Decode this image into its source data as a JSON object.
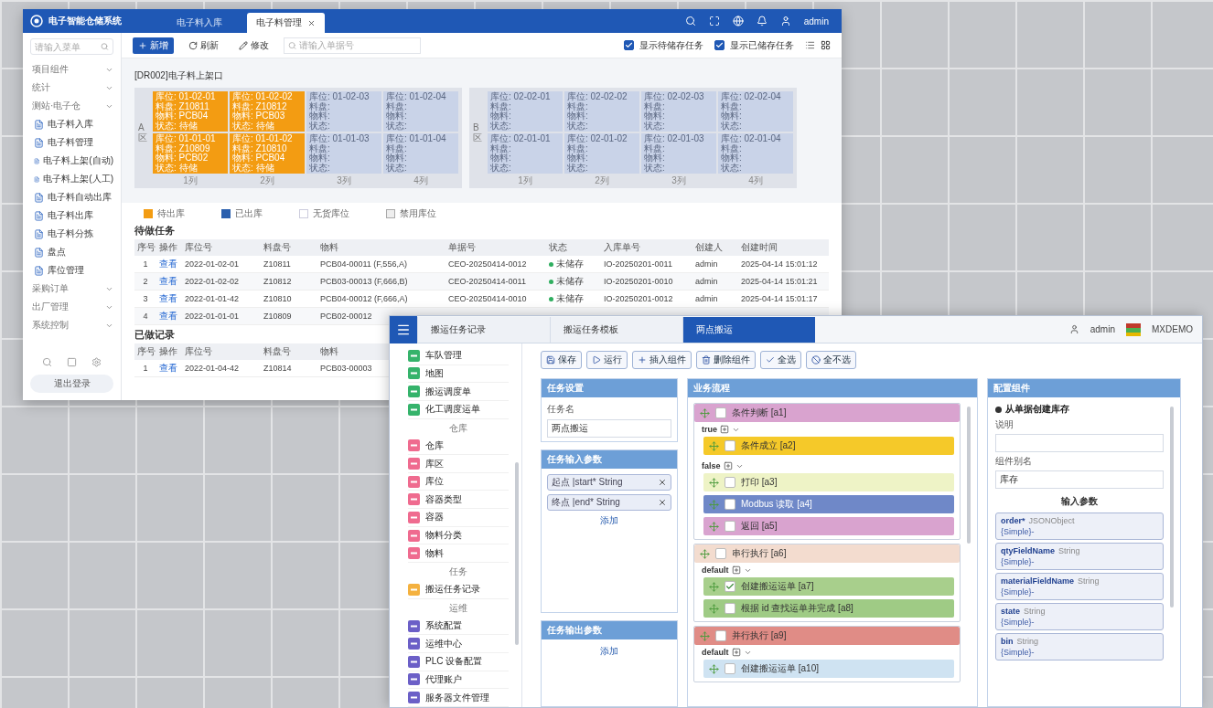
{
  "main_window": {
    "app_title": "电子智能仓储系统",
    "tabs": [
      {
        "label": "电子料入库",
        "selected": false
      },
      {
        "label": "电子料管理",
        "selected": true
      }
    ],
    "user": "admin",
    "sidebar": {
      "search_placeholder": "请输入菜单",
      "items": [
        {
          "kind": "group",
          "label": "项目组件"
        },
        {
          "kind": "group",
          "label": "统计"
        },
        {
          "kind": "group",
          "label": "测站·电子仓"
        },
        {
          "kind": "page",
          "label": "电子料入库"
        },
        {
          "kind": "page",
          "label": "电子料管理"
        },
        {
          "kind": "page",
          "label": "电子料上架(自动)"
        },
        {
          "kind": "page",
          "label": "电子料上架(人工)"
        },
        {
          "kind": "page",
          "label": "电子料自动出库"
        },
        {
          "kind": "page",
          "label": "电子料出库"
        },
        {
          "kind": "page",
          "label": "电子料分拣"
        },
        {
          "kind": "page",
          "label": "盘点"
        },
        {
          "kind": "page",
          "label": "库位管理"
        },
        {
          "kind": "group",
          "label": "采购订单"
        },
        {
          "kind": "group",
          "label": "出厂管理"
        },
        {
          "kind": "group",
          "label": "系统控制"
        }
      ],
      "logout": "退出登录"
    },
    "toolbar": {
      "buttons": [
        {
          "kind": "add",
          "label": "新增"
        },
        {
          "kind": "refresh",
          "label": "刷新"
        },
        {
          "kind": "edit",
          "label": "修改"
        }
      ],
      "search_placeholder": "请输入单据号",
      "filters": [
        {
          "label": "显示待储存任务",
          "checked": true
        },
        {
          "label": "显示已储存任务",
          "checked": true
        }
      ]
    },
    "rack_panel": {
      "title": "[DR002]电子料上架口",
      "racks": [
        {
          "side_label": "A区",
          "column_labels": [
            "1列",
            "2列",
            "3列",
            "4列"
          ],
          "cells": [
            {
              "kind": "occupied",
              "lines": [
                "库位: 01-02-01",
                "料盘: Z10811",
                "物料: PCB04",
                "状态: 待储"
              ]
            },
            {
              "kind": "occupied",
              "lines": [
                "库位: 01-02-02",
                "料盘: Z10812",
                "物料: PCB03",
                "状态: 待储"
              ]
            },
            {
              "kind": "empty",
              "lines": [
                "库位: 01-02-03",
                "料盘:",
                "物料:",
                "状态:"
              ]
            },
            {
              "kind": "empty",
              "lines": [
                "库位: 01-02-04",
                "料盘:",
                "物料:",
                "状态:"
              ]
            },
            {
              "kind": "occupied",
              "lines": [
                "库位: 01-01-01",
                "料盘: Z10809",
                "物料: PCB02",
                "状态: 待储"
              ]
            },
            {
              "kind": "occupied",
              "lines": [
                "库位: 01-01-02",
                "料盘: Z10810",
                "物料: PCB04",
                "状态: 待储"
              ]
            },
            {
              "kind": "empty",
              "lines": [
                "库位: 01-01-03",
                "料盘:",
                "物料:",
                "状态:"
              ]
            },
            {
              "kind": "empty",
              "lines": [
                "库位: 01-01-04",
                "料盘:",
                "物料:",
                "状态:"
              ]
            }
          ]
        },
        {
          "side_label": "B区",
          "column_labels": [
            "1列",
            "2列",
            "3列",
            "4列"
          ],
          "cells": [
            {
              "kind": "empty",
              "lines": [
                "库位: 02-02-01",
                "料盘:",
                "物料:",
                "状态:"
              ]
            },
            {
              "kind": "empty",
              "lines": [
                "库位: 02-02-02",
                "料盘:",
                "物料:",
                "状态:"
              ]
            },
            {
              "kind": "empty",
              "lines": [
                "库位: 02-02-03",
                "料盘:",
                "物料:",
                "状态:"
              ]
            },
            {
              "kind": "empty",
              "lines": [
                "库位: 02-02-04",
                "料盘:",
                "物料:",
                "状态:"
              ]
            },
            {
              "kind": "empty",
              "lines": [
                "库位: 02-01-01",
                "料盘:",
                "物料:",
                "状态:"
              ]
            },
            {
              "kind": "empty",
              "lines": [
                "库位: 02-01-02",
                "料盘:",
                "物料:",
                "状态:"
              ]
            },
            {
              "kind": "empty",
              "lines": [
                "库位: 02-01-03",
                "料盘:",
                "物料:",
                "状态:"
              ]
            },
            {
              "kind": "empty",
              "lines": [
                "库位: 02-01-04",
                "料盘:",
                "物料:",
                "状态:"
              ]
            }
          ]
        }
      ]
    },
    "legend": [
      {
        "kind": "pending",
        "label": "待出库"
      },
      {
        "kind": "done",
        "label": "已出库"
      },
      {
        "kind": "empty",
        "label": "无货库位"
      },
      {
        "kind": "disabled",
        "label": "禁用库位"
      }
    ],
    "pending_tasks": {
      "title": "待做任务",
      "columns": [
        "序号",
        "操作",
        "库位号",
        "料盘号",
        "物料",
        "单据号",
        "状态",
        "入库单号",
        "创建人",
        "创建时间"
      ],
      "rows": [
        {
          "no": "1",
          "action": "查看",
          "bin": "2022-01-02-01",
          "tray": "Z10811",
          "material": "PCB04-00011 (F,556,A)",
          "order": "CEO-20250414-0012",
          "status": "未储存",
          "inbound": "IO-20250201-0011",
          "creator": "admin",
          "created": "2025-04-14 15:01:12"
        },
        {
          "no": "2",
          "action": "查看",
          "bin": "2022-01-02-02",
          "tray": "Z10812",
          "material": "PCB03-00013 (F,666,B)",
          "order": "CEO-20250414-0011",
          "status": "未储存",
          "inbound": "IO-20250201-0010",
          "creator": "admin",
          "created": "2025-04-14 15:01:21"
        },
        {
          "no": "3",
          "action": "查看",
          "bin": "2022-01-01-42",
          "tray": "Z10810",
          "material": "PCB04-00012 (F,666,A)",
          "order": "CEO-20250414-0010",
          "status": "未储存",
          "inbound": "IO-20250201-0012",
          "creator": "admin",
          "created": "2025-04-14 15:01:17"
        },
        {
          "no": "4",
          "action": "查看",
          "bin": "2022-01-01-01",
          "tray": "Z10809",
          "material": "PCB02-00012"
        }
      ]
    },
    "done_records": {
      "title": "已做记录",
      "columns": [
        "序号",
        "操作",
        "库位号",
        "料盘号",
        "物料"
      ],
      "rows": [
        {
          "no": "1",
          "action": "查看",
          "bin": "2022-01-04-42",
          "tray": "Z10814",
          "material": "PCB03-00003"
        }
      ]
    }
  },
  "editor_window": {
    "tabs": [
      {
        "label": "搬运任务记录",
        "selected": false
      },
      {
        "label": "搬运任务模板",
        "selected": false
      },
      {
        "label": "两点搬运",
        "selected": true
      }
    ],
    "user": "admin",
    "brand": "MXDEMO",
    "sidebar": [
      {
        "kind": "item",
        "label": "车队管理",
        "color": "#35b36b"
      },
      {
        "kind": "item",
        "label": "地图",
        "color": "#35b36b"
      },
      {
        "kind": "item",
        "label": "搬运调度单",
        "color": "#35b36b"
      },
      {
        "kind": "item",
        "label": "化工调度运单",
        "color": "#35b36b"
      },
      {
        "kind": "section",
        "label": "仓库"
      },
      {
        "kind": "item",
        "label": "仓库",
        "color": "#ef6b8f"
      },
      {
        "kind": "item",
        "label": "库区",
        "color": "#ef6b8f"
      },
      {
        "kind": "item",
        "label": "库位",
        "color": "#ef6b8f"
      },
      {
        "kind": "item",
        "label": "容器类型",
        "color": "#ef6b8f"
      },
      {
        "kind": "item",
        "label": "容器",
        "color": "#ef6b8f"
      },
      {
        "kind": "item",
        "label": "物料分类",
        "color": "#ef6b8f"
      },
      {
        "kind": "item",
        "label": "物料",
        "color": "#ef6b8f"
      },
      {
        "kind": "section",
        "label": "任务"
      },
      {
        "kind": "item",
        "label": "搬运任务记录",
        "color": "#f4b13f"
      },
      {
        "kind": "section",
        "label": "运维"
      },
      {
        "kind": "item",
        "label": "系统配置",
        "color": "#6b5fc7"
      },
      {
        "kind": "item",
        "label": "运维中心",
        "color": "#6b5fc7"
      },
      {
        "kind": "item",
        "label": "PLC 设备配置",
        "color": "#6b5fc7"
      },
      {
        "kind": "item",
        "label": "代理账户",
        "color": "#6b5fc7"
      },
      {
        "kind": "item",
        "label": "服务器文件管理",
        "color": "#6b5fc7"
      }
    ],
    "toolbar": [
      {
        "kind": "save",
        "label": "保存"
      },
      {
        "kind": "run",
        "label": "运行"
      },
      {
        "kind": "insert",
        "label": "插入组件"
      },
      {
        "kind": "delete",
        "label": "删除组件"
      },
      {
        "kind": "all",
        "label": "全选"
      },
      {
        "kind": "none",
        "label": "全不选"
      }
    ],
    "task_settings": {
      "title": "任务设置",
      "name_label": "任务名",
      "name_value": "两点搬运"
    },
    "input_params": {
      "title": "任务输入参数",
      "params": [
        "起点 |start* String",
        "终点 |end* String"
      ],
      "add": "添加"
    },
    "output_params": {
      "title": "任务输出参数",
      "add": "添加"
    },
    "flow": {
      "title": "业务流程",
      "blocks": [
        {
          "label": "条件判断 [a1]",
          "color": "#d9a3cf",
          "checked": false,
          "branches": [
            {
              "label": "true",
              "blocks": [
                {
                  "label": "条件成立 [a2]",
                  "color": "#f5c929",
                  "checked": false
                }
              ]
            },
            {
              "label": "false",
              "blocks": [
                {
                  "label": "打印 [a3]",
                  "color": "#eef3c6",
                  "checked": false
                },
                {
                  "label": "Modbus 读取 [a4]",
                  "color": "#6f88c8",
                  "checked": false
                },
                {
                  "label": "返回 [a5]",
                  "color": "#d9a3cf",
                  "checked": false
                }
              ]
            }
          ]
        },
        {
          "label": "串行执行 [a6]",
          "color": "#f3dccf",
          "checked": false,
          "branches": [
            {
              "label": "default",
              "blocks": [
                {
                  "label": "创建搬运运单 [a7]",
                  "color": "#a8cf8c",
                  "checked": true
                },
                {
                  "label": "根据 id 查找运单并完成 [a8]",
                  "color": "#9fcb85",
                  "checked": false
                }
              ]
            }
          ]
        },
        {
          "label": "并行执行 [a9]",
          "color": "#e08c86",
          "checked": false,
          "branches": [
            {
              "label": "default",
              "blocks": [
                {
                  "label": "创建搬运运单 [a10]",
                  "color": "#cfe3f2",
                  "checked": false
                }
              ]
            }
          ]
        }
      ]
    },
    "config": {
      "title": "配置组件",
      "component": "从单据创建库存",
      "desc_label": "说明",
      "alias_label": "组件别名",
      "alias_value": "库存",
      "params_title": "输入参数",
      "params": [
        {
          "name": "order*",
          "type": "JSONObject",
          "value": "{Simple}-"
        },
        {
          "name": "qtyFieldName",
          "type": "String",
          "value": "{Simple}-"
        },
        {
          "name": "materialFieldName",
          "type": "String",
          "value": "{Simple}-"
        },
        {
          "name": "state",
          "type": "String",
          "value": "{Simple}-"
        },
        {
          "name": "bin",
          "type": "String",
          "value": "{Simple}-"
        }
      ]
    }
  }
}
